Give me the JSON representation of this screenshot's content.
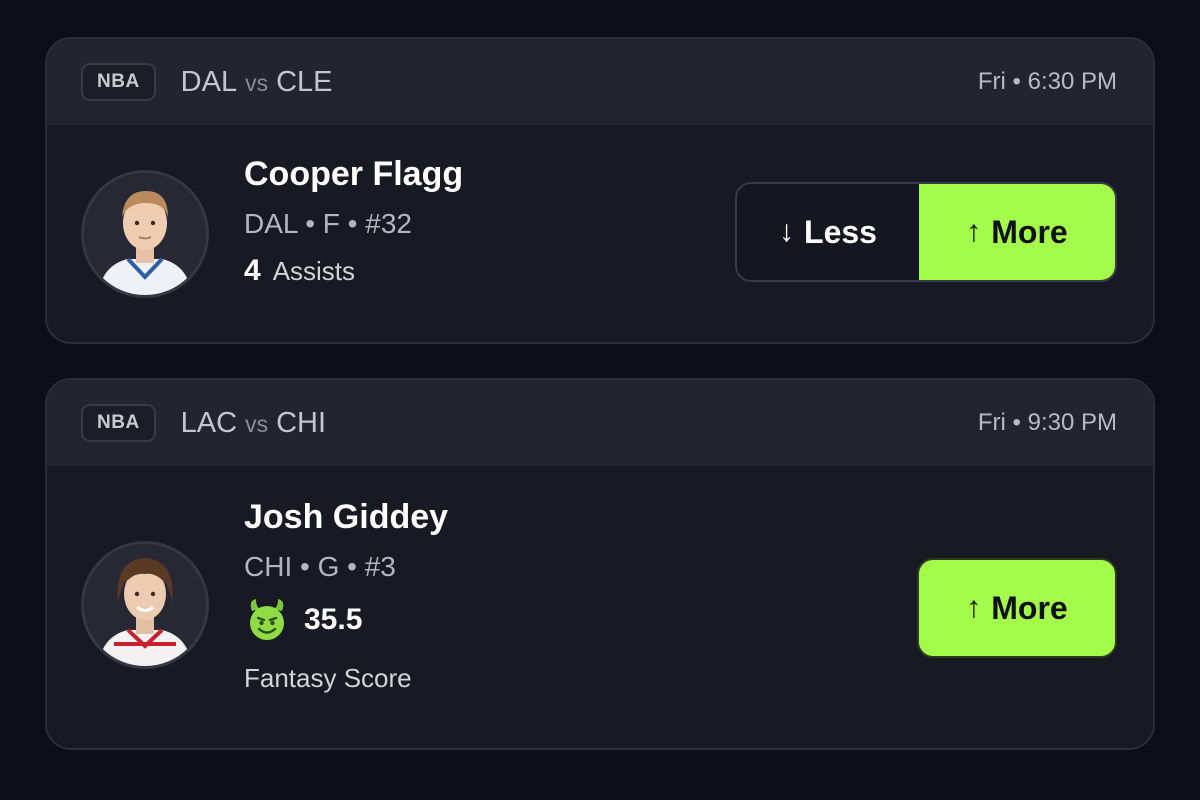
{
  "cards": [
    {
      "league": "NBA",
      "team_a": "DAL",
      "vs": "vs",
      "team_b": "CLE",
      "time": "Fri • 6:30 PM",
      "player": {
        "name": "Cooper Flagg",
        "meta": "DAL • F • #32",
        "avatar_icon": "player-headshot-flagg"
      },
      "stat": {
        "value": "4",
        "label": "Assists"
      },
      "buttons": {
        "less_arrow": "↓",
        "less_label": "Less",
        "more_arrow": "↑",
        "more_label": "More"
      }
    },
    {
      "league": "NBA",
      "team_a": "LAC",
      "vs": "vs",
      "team_b": "CHI",
      "time": "Fri • 9:30 PM",
      "player": {
        "name": "Josh Giddey",
        "meta": "CHI • G • #3",
        "avatar_icon": "player-headshot-giddey"
      },
      "stat": {
        "value": "35.5",
        "label": "Fantasy Score",
        "icon": "devil-emoji-icon"
      },
      "buttons": {
        "more_arrow": "↑",
        "more_label": "More"
      }
    }
  ],
  "colors": {
    "background": "#0d0e18",
    "card": "#181922",
    "card_header": "#232430",
    "accent_green": "#a3fa4b"
  }
}
